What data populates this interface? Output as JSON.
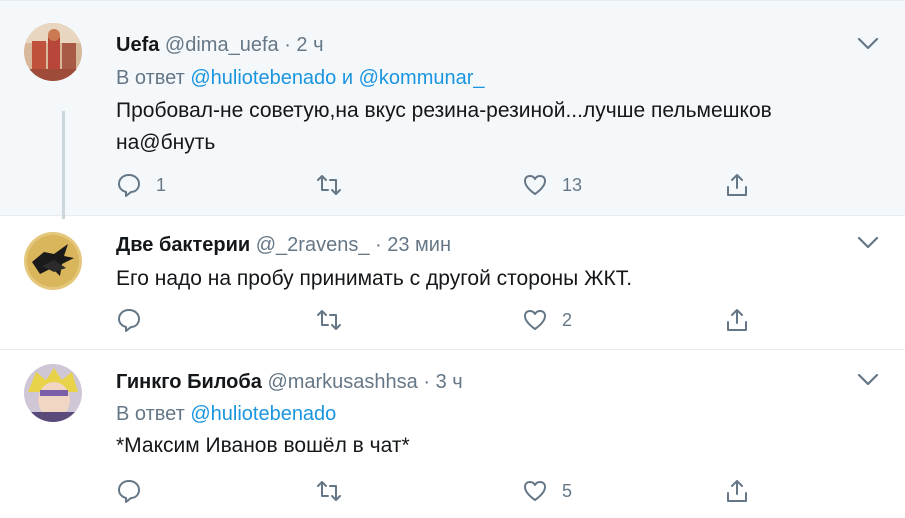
{
  "tweets": [
    {
      "name": "Uefa",
      "handle": "@dima_uefa",
      "dot": "·",
      "time": "2 ч",
      "reply_prefix": "В ответ",
      "reply_user1": "@huliotebenado",
      "reply_and": "и",
      "reply_user2": "@kommunar_",
      "text": "Пробовал-не советую,на вкус резина-резиной...лучше пельмешков на@бнуть",
      "reply_count": "1",
      "like_count": "13"
    },
    {
      "name": "Две бактерии",
      "handle": "@_2ravens_",
      "dot": "·",
      "time": "23 мин",
      "text": "Его надо на пробу принимать с другой стороны ЖКТ.",
      "reply_count": "",
      "like_count": "2"
    },
    {
      "name": "Гинкго Билоба",
      "handle": "@markusashhsa",
      "dot": "·",
      "time": "3 ч",
      "reply_prefix": "В ответ",
      "reply_user1": "@huliotebenado",
      "text": "*Максим Иванов вошёл в чат*",
      "reply_count": "",
      "like_count": "5"
    }
  ],
  "icons": {
    "reply": "reply-icon",
    "retweet": "retweet-icon",
    "like": "like-icon",
    "share": "share-icon",
    "caret": "chevron-down-icon"
  },
  "colors": {
    "background_highlight": "#f5f8fa",
    "link": "#1b95e0",
    "secondary_text": "#657786",
    "divider": "#e6ecf0"
  }
}
